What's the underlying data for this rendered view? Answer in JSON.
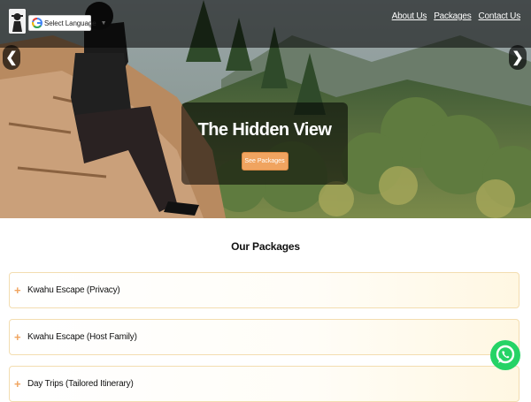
{
  "header": {
    "language_label": "Select Language",
    "nav": [
      "About Us",
      "Packages",
      "Contact Us"
    ]
  },
  "hero": {
    "title": "The Hidden View",
    "button_label": "See Packages",
    "prev_glyph": "❮",
    "next_glyph": "❯"
  },
  "packages": {
    "title": "Our Packages",
    "items": [
      {
        "icon": "+",
        "label": "Kwahu Escape (Privacy)"
      },
      {
        "icon": "+",
        "label": "Kwahu Escape (Host Family)"
      },
      {
        "icon": "+",
        "label": "Day Trips (Tailored Itinerary)"
      }
    ]
  },
  "colors": {
    "accent": "#f0a460",
    "card_border": "#f3ddb0",
    "whatsapp": "#25d366",
    "topbar": "rgba(0,0,0,0.55)"
  },
  "icons": {
    "logo": "traveler-logo-icon",
    "language": "google-g-icon",
    "contact": "whatsapp-icon"
  }
}
